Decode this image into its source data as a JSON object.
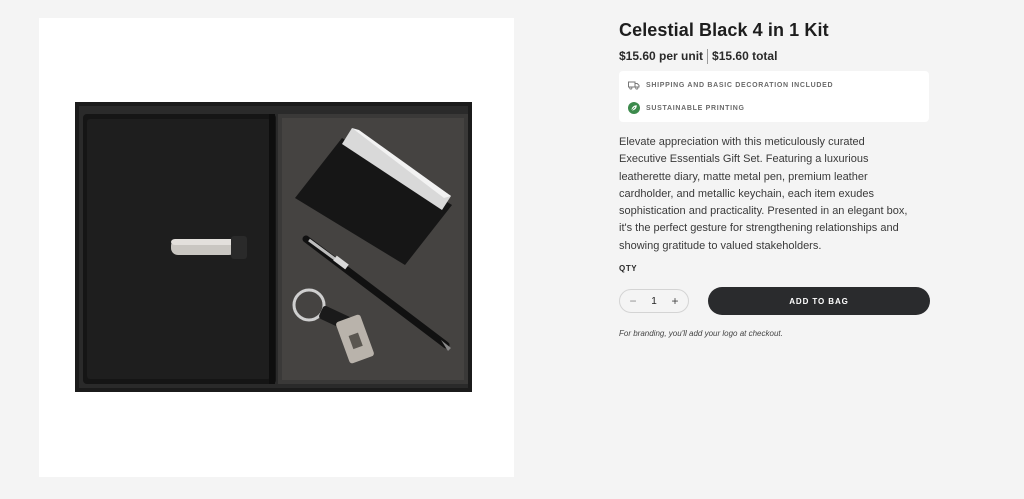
{
  "product": {
    "title": "Celestial Black 4 in 1 Kit",
    "price_unit": "$15.60 per unit",
    "price_total": "$15.60 total",
    "image_alt": "Black gift box with diary, card holder, pen and keychain"
  },
  "perks": [
    {
      "label": "SHIPPING AND BASIC DECORATION INCLUDED",
      "icon": "truck-icon"
    },
    {
      "label": "SUSTAINABLE PRINTING",
      "icon": "leaf-icon"
    }
  ],
  "description": "Elevate appreciation with this meticulously curated Executive Essentials Gift Set. Featuring a luxurious leatherette diary, matte metal pen, premium leather cardholder, and metallic keychain, each item exudes sophistication and practicality. Presented in an elegant box, it's the perfect gesture for strengthening relationships and showing gratitude to valued stakeholders.",
  "qty": {
    "label": "QTY",
    "value": "1",
    "decrement": "−",
    "increment": "+"
  },
  "add_to_bag": "ADD TO BAG",
  "note": "For branding, you'll add your logo at checkout.",
  "colors": {
    "button_bg": "#2a2b2d",
    "leaf_green": "#3c8a4c",
    "page_bg": "#f4f4f4"
  }
}
